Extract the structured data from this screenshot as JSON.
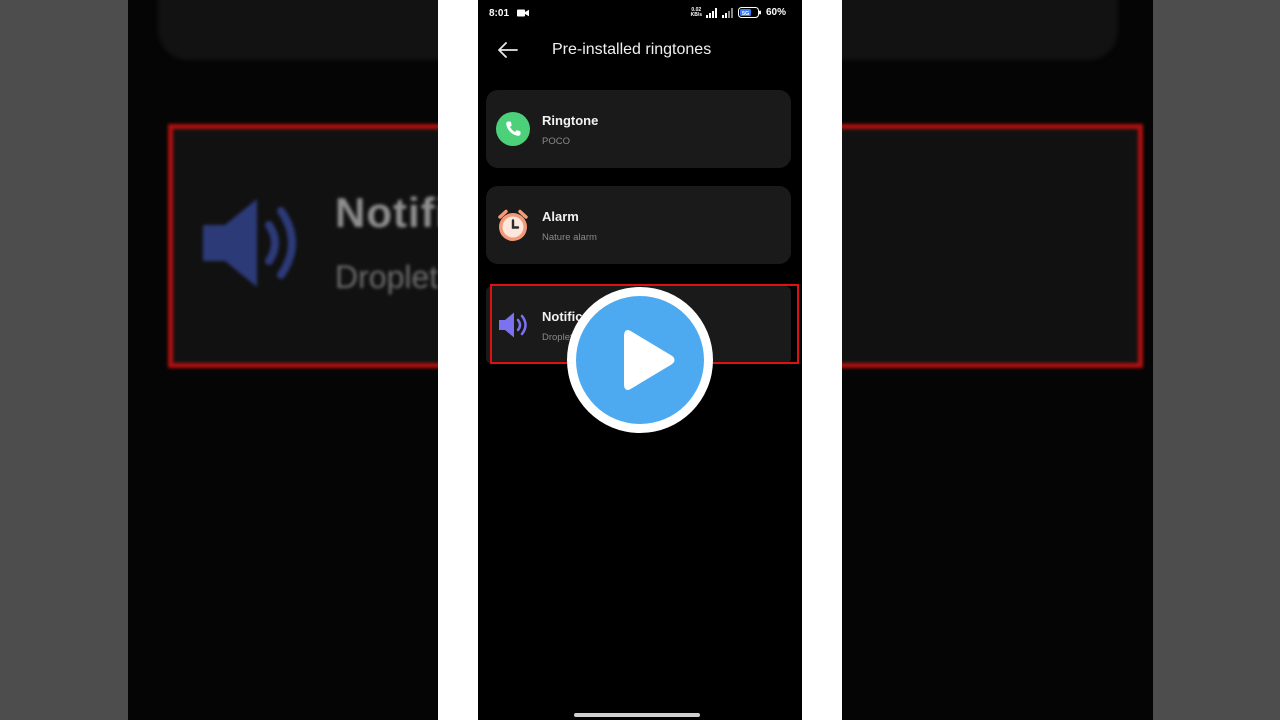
{
  "status_bar": {
    "time": "8:01",
    "net_speed_value": "0.02",
    "net_speed_unit": "KB/s",
    "network_badge": "5G",
    "battery_percent": "60%"
  },
  "header": {
    "title": "Pre-installed ringtones"
  },
  "items": [
    {
      "title": "Ringtone",
      "subtitle": "POCO",
      "icon": "phone-icon",
      "icon_color": "#4cd07a"
    },
    {
      "title": "Alarm",
      "subtitle": "Nature alarm",
      "icon": "alarm-clock-icon",
      "icon_color": "#f39a79"
    },
    {
      "title": "Notific",
      "subtitle": "Droplet",
      "icon": "speaker-icon",
      "icon_color": "#7a72ee"
    }
  ],
  "backdrop": {
    "title": "Notific",
    "subtitle": "Droplet"
  },
  "colors": {
    "highlight": "#e01010",
    "play_button": "#4eaaf0"
  }
}
